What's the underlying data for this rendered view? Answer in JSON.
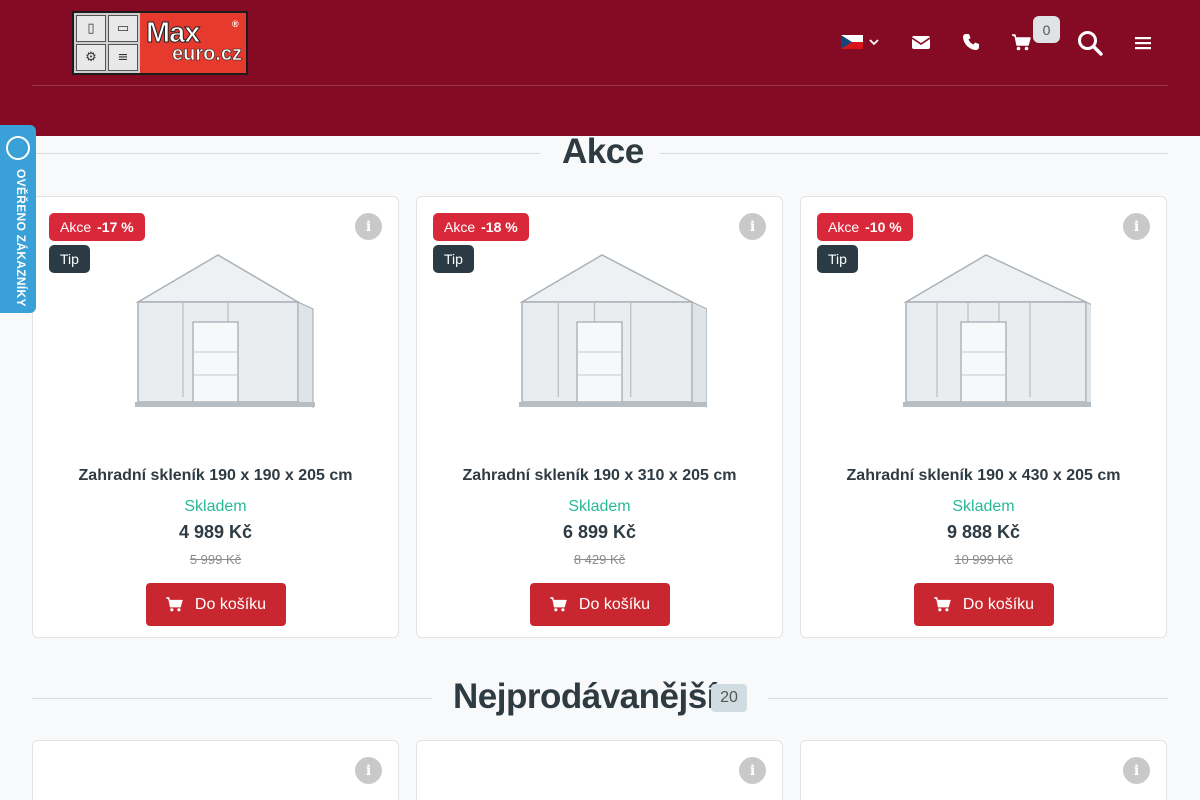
{
  "header": {
    "logo": {
      "brand": "Max",
      "domain": "euro.cz",
      "registered": "®"
    },
    "cart_count": "0",
    "colors": {
      "header_bg": "#850b25",
      "accent_red": "#c9272f",
      "badge_blue": "#3aa0d8"
    },
    "icons": [
      "flag-cz-icon",
      "chevron-down-icon",
      "envelope-icon",
      "phone-icon",
      "cart-icon",
      "search-icon",
      "menu-icon"
    ]
  },
  "side_badge": {
    "label": "OVĚŘENO ZÁKAZNÍKY"
  },
  "sections": {
    "akce_title": "Akce",
    "bestsellers_title": "Nejprodávanější",
    "bestsellers_count": "20"
  },
  "products": [
    {
      "tag_akce": "Akce",
      "discount": "-17 %",
      "tag_tip": "Tip",
      "name": "Zahradní skleník 190 x 190 x 205 cm",
      "stock": "Skladem",
      "price": "4 989 Kč",
      "old_price": "5 999 Kč",
      "cart_label": "Do košíku",
      "size_level": 1
    },
    {
      "tag_akce": "Akce",
      "discount": "-18 %",
      "tag_tip": "Tip",
      "name": "Zahradní skleník 190 x 310 x 205 cm",
      "stock": "Skladem",
      "price": "6 899 Kč",
      "old_price": "8 429 Kč",
      "cart_label": "Do košíku",
      "size_level": 2
    },
    {
      "tag_akce": "Akce",
      "discount": "-10 %",
      "tag_tip": "Tip",
      "name": "Zahradní skleník 190 x 430 x 205 cm",
      "stock": "Skladem",
      "price": "9 888 Kč",
      "old_price": "10 999 Kč",
      "cart_label": "Do košíku",
      "size_level": 3
    }
  ]
}
